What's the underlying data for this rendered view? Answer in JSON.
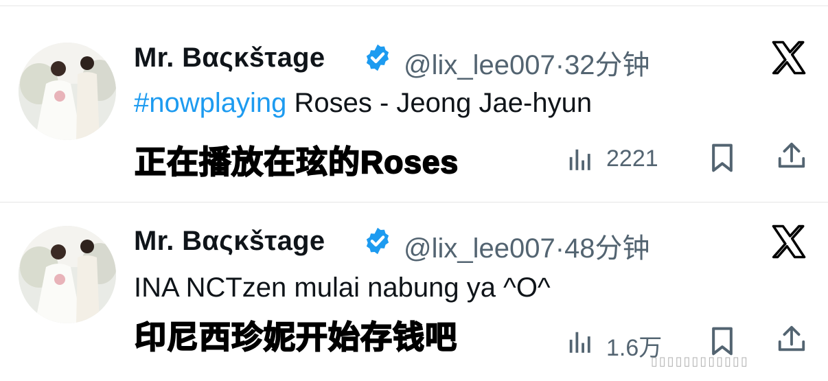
{
  "tweets": [
    {
      "display_name": "Mr. Βαςκšτage",
      "handle_time": "@lix_lee007·32分钟",
      "hashtag": "#nowplaying",
      "text": " Roses - Jeong Jae-hyun",
      "caption": "正在播放在玹的Roses",
      "views": "2221"
    },
    {
      "display_name": "Mr. Βαςκšτage",
      "handle_time": "@lix_lee007·48分钟",
      "hashtag": "",
      "text": "INA NCTzen mulai nabung ya ^O^",
      "caption": "印尼西珍妮开始存钱吧",
      "views": "1.6万"
    }
  ],
  "colors": {
    "accent": "#1d9bf0",
    "secondary_text": "#536471",
    "verified": "#1d9bf0"
  },
  "icons": [
    "verified-badge-icon",
    "x-logo-icon",
    "views-chart-icon",
    "bookmark-icon",
    "share-icon"
  ]
}
